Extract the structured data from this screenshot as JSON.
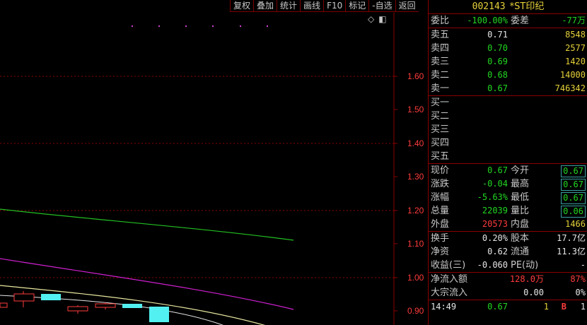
{
  "toolbar": {
    "items": [
      "复权",
      "叠加",
      "统计",
      "画线",
      "F10",
      "标记",
      "-自选",
      "返回"
    ]
  },
  "icons": [
    "diamond-icon",
    "panel-icon"
  ],
  "price_axis": [
    "1.60",
    "1.50",
    "1.40",
    "1.30",
    "1.20",
    "1.10",
    "1.00",
    "0.90"
  ],
  "quote": {
    "code": "002143",
    "name": "*ST印纪",
    "weibi_label": "委比",
    "weibi_value": "-100.00%",
    "weicha_label": "委差",
    "weicha_value": "-77万",
    "asks": [
      {
        "label": "卖五",
        "price": "0.71",
        "vol": "8548"
      },
      {
        "label": "卖四",
        "price": "0.70",
        "vol": "2577"
      },
      {
        "label": "卖三",
        "price": "0.69",
        "vol": "1420"
      },
      {
        "label": "卖二",
        "price": "0.68",
        "vol": "14000"
      },
      {
        "label": "卖一",
        "price": "0.67",
        "vol": "746342"
      }
    ],
    "bids": [
      {
        "label": "买一"
      },
      {
        "label": "买二"
      },
      {
        "label": "买三"
      },
      {
        "label": "买四"
      },
      {
        "label": "买五"
      }
    ],
    "stats": [
      {
        "l1": "现价",
        "v1": "0.67",
        "l2": "今开",
        "v2": "0.67"
      },
      {
        "l1": "涨跌",
        "v1": "-0.04",
        "l2": "最高",
        "v2": "0.67"
      },
      {
        "l1": "涨幅",
        "v1": "-5.63%",
        "l2": "最低",
        "v2": "0.67"
      },
      {
        "l1": "总量",
        "v1": "22039",
        "l2": "量比",
        "v2": "0.06"
      },
      {
        "l1": "外盘",
        "v1": "20573",
        "l2": "内盘",
        "v2": "1466"
      }
    ],
    "fund": [
      {
        "l1": "换手",
        "v1": "0.20%",
        "l2": "股本",
        "v2": "17.7亿"
      },
      {
        "l1": "净资",
        "v1": "0.62",
        "l2": "流通",
        "v2": "11.3亿"
      },
      {
        "l1": "收益(三)",
        "v1": "-0.060",
        "l2": "PE(动)",
        "v2": "-"
      }
    ],
    "flow": {
      "label": "净流入额",
      "value": "128.0万",
      "pct": "87%"
    },
    "block": {
      "label": "大宗流入",
      "value": "0.00",
      "pct": "0%"
    },
    "tick": {
      "time": "14:49",
      "price": "0.67",
      "vol": "1",
      "side": "B",
      "count": "1"
    }
  }
}
